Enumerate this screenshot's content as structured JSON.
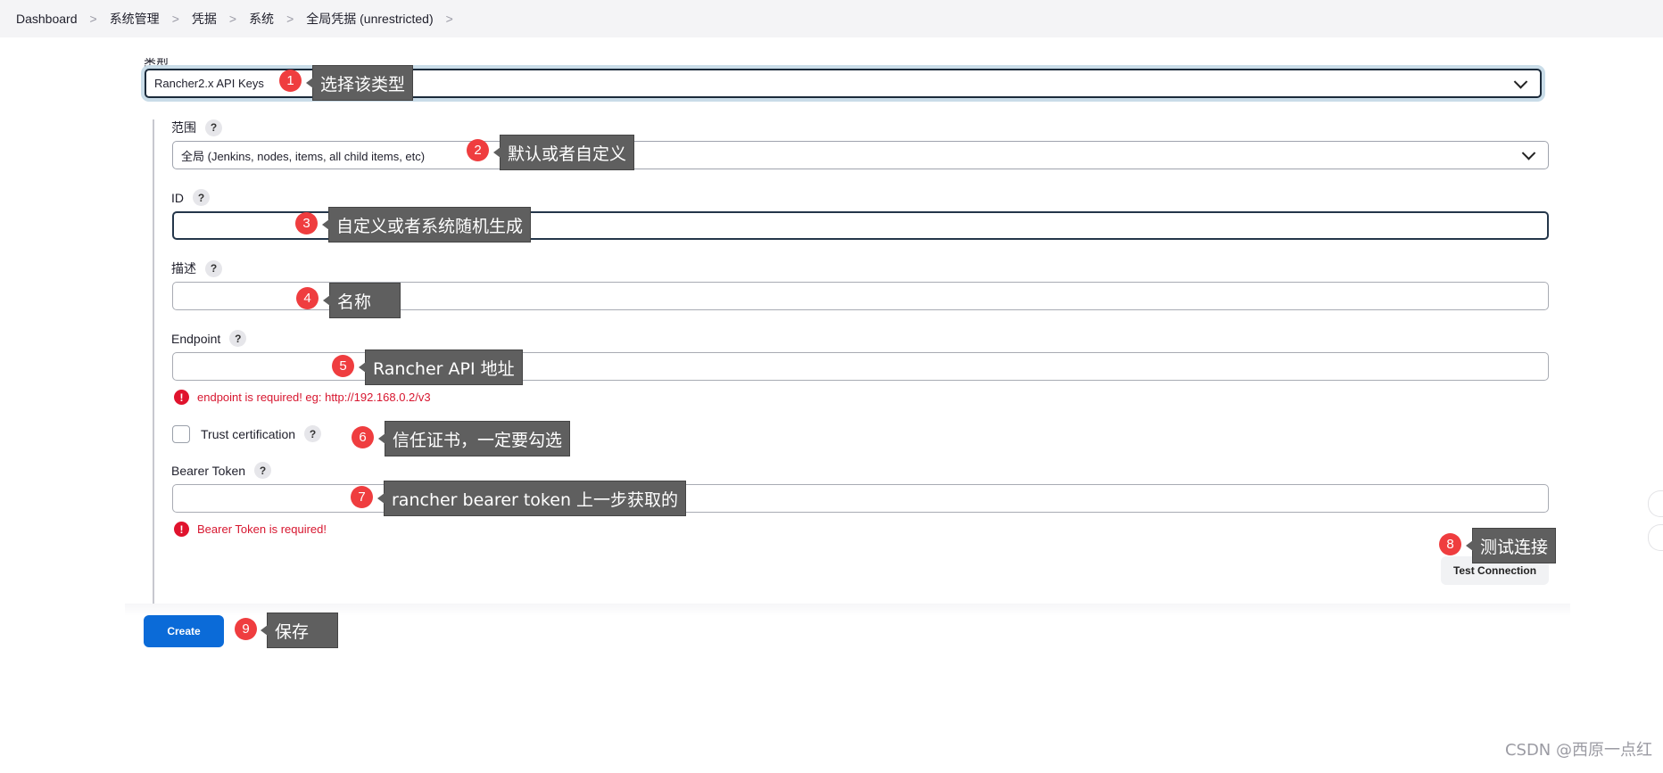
{
  "breadcrumb": [
    "Dashboard",
    "系统管理",
    "凭据",
    "系统",
    "全局凭据 (unrestricted)"
  ],
  "breadcrumb_separator": ">",
  "form": {
    "type_label": "类型",
    "type_value": "Rancher2.x API Keys",
    "scope_label": "范围",
    "scope_value": "全局 (Jenkins, nodes, items, all child items, etc)",
    "id_label": "ID",
    "id_value": "",
    "description_label": "描述",
    "description_value": "",
    "endpoint_label": "Endpoint",
    "endpoint_value": "",
    "endpoint_error": "endpoint is required! eg: http://192.168.0.2/v3",
    "trust_label": "Trust certification",
    "bearer_label": "Bearer Token",
    "bearer_value": "",
    "bearer_error": "Bearer Token is required!",
    "help_glyph": "?",
    "error_glyph": "!",
    "test_connection_label": "Test Connection",
    "create_label": "Create"
  },
  "annotations": [
    {
      "number": "1",
      "text": "选择该类型"
    },
    {
      "number": "2",
      "text": "默认或者自定义"
    },
    {
      "number": "3",
      "text": "自定义或者系统随机生成"
    },
    {
      "number": "4",
      "text": "名称"
    },
    {
      "number": "5",
      "text": "Rancher API 地址"
    },
    {
      "number": "6",
      "text": "信任证书，一定要勾选"
    },
    {
      "number": "7",
      "text": "rancher bearer token 上一步获取的"
    },
    {
      "number": "8",
      "text": "测试连接"
    },
    {
      "number": "9",
      "text": "保存"
    }
  ],
  "watermark": "CSDN @西原一点红",
  "colors": {
    "primary_button": "#0b6bd8",
    "error": "#d7162f",
    "marker": "#ef3d3f",
    "callout": "#5f5f5f",
    "focus_ring": "#c9dce8"
  }
}
